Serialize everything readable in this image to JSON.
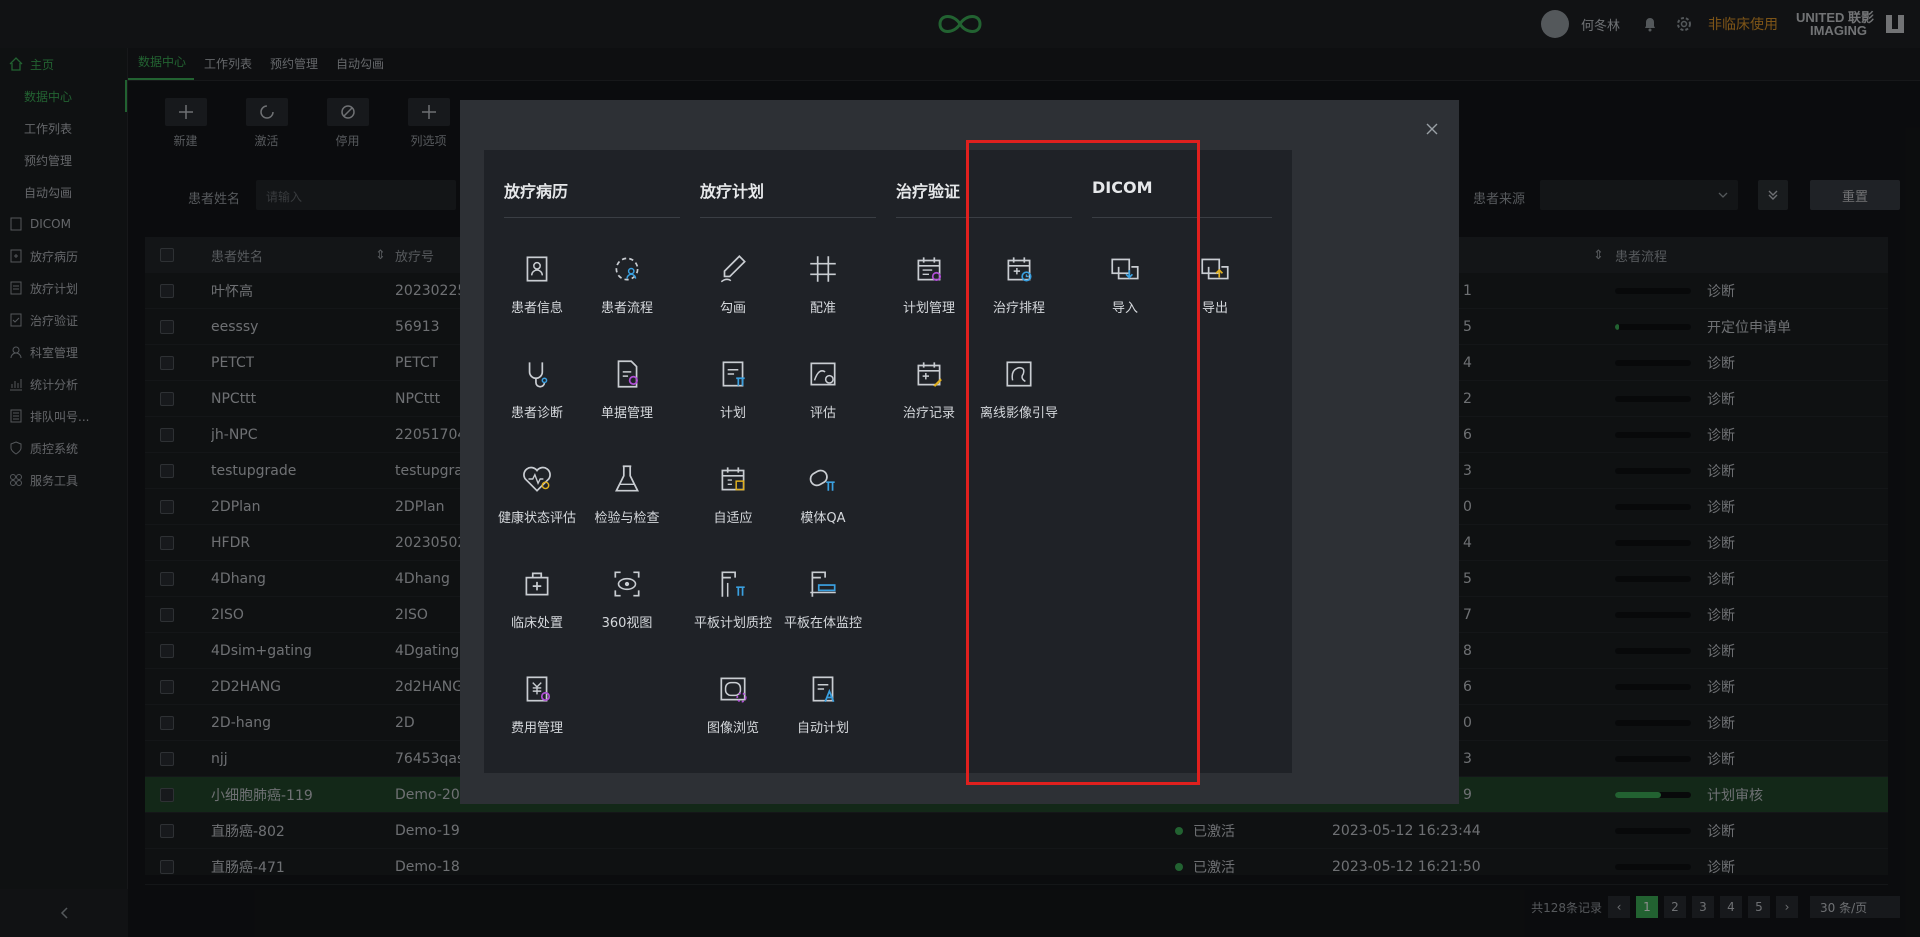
{
  "header": {
    "username": "何冬林",
    "nonclinical_label": "非临床使用",
    "brand_line1": "UNITED 联影",
    "brand_line2": "IMAGING"
  },
  "sidebar": {
    "items": [
      {
        "label": "主页",
        "icon": "home-icon"
      },
      {
        "label": "数据中心"
      },
      {
        "label": "工作列表"
      },
      {
        "label": "预约管理"
      },
      {
        "label": "自动勾画"
      },
      {
        "label": "DICOM",
        "icon": "file-icon"
      },
      {
        "label": "放疗病历",
        "icon": "record-icon"
      },
      {
        "label": "放疗计划",
        "icon": "plan-icon"
      },
      {
        "label": "治疗验证",
        "icon": "verify-icon"
      },
      {
        "label": "科室管理",
        "icon": "dept-icon"
      },
      {
        "label": "统计分析",
        "icon": "chart-icon"
      },
      {
        "label": "排队叫号...",
        "icon": "queue-icon"
      },
      {
        "label": "质控系统",
        "icon": "shield-icon"
      },
      {
        "label": "服务工具",
        "icon": "tools-icon"
      }
    ]
  },
  "tabs": [
    "数据中心",
    "工作列表",
    "预约管理",
    "自动勾画"
  ],
  "toolbar": [
    "新建",
    "激活",
    "停用",
    "列选项"
  ],
  "filters": {
    "patient_name_label": "患者姓名",
    "patient_name_placeholder": "请输入",
    "source_label": "患者来源",
    "reset_label": "重置"
  },
  "table": {
    "columns": [
      "患者姓名",
      "放疗号",
      "患者流程"
    ],
    "rows": [
      {
        "name": "叶怀高",
        "id": "20230225",
        "tail": "1",
        "flow": "诊断",
        "progress": 0
      },
      {
        "name": "eesssy",
        "id": "56913",
        "tail": "5",
        "flow": "开定位申请单",
        "progress": 0.05
      },
      {
        "name": "PETCT",
        "id": "PETCT",
        "tail": "4",
        "flow": "诊断",
        "progress": 0
      },
      {
        "name": "NPCttt",
        "id": "NPCttt",
        "tail": "2",
        "flow": "诊断",
        "progress": 0
      },
      {
        "name": "jh-NPC",
        "id": "22051704",
        "tail": "6",
        "flow": "诊断",
        "progress": 0
      },
      {
        "name": "testupgrade",
        "id": "testupgra",
        "tail": "3",
        "flow": "诊断",
        "progress": 0
      },
      {
        "name": "2DPlan",
        "id": "2DPlan",
        "tail": "0",
        "flow": "诊断",
        "progress": 0
      },
      {
        "name": "HFDR",
        "id": "20230502",
        "tail": "4",
        "flow": "诊断",
        "progress": 0
      },
      {
        "name": "4Dhang",
        "id": "4Dhang",
        "tail": "5",
        "flow": "诊断",
        "progress": 0
      },
      {
        "name": "2ISO",
        "id": "2ISO",
        "tail": "7",
        "flow": "诊断",
        "progress": 0
      },
      {
        "name": "4Dsim+gating",
        "id": "4Dgating",
        "tail": "8",
        "flow": "诊断",
        "progress": 0
      },
      {
        "name": "2D2HANG",
        "id": "2d2HANG",
        "tail": "6",
        "flow": "诊断",
        "progress": 0
      },
      {
        "name": "2D-hang",
        "id": "2D",
        "tail": "0",
        "flow": "诊断",
        "progress": 0
      },
      {
        "name": "njj",
        "id": "76453qas",
        "tail": "3",
        "flow": "诊断",
        "progress": 0
      },
      {
        "name": "小细胞肺癌-119",
        "id": "Demo-20",
        "tail": "9",
        "flow": "计划审核",
        "progress": 0.6,
        "selected": true
      },
      {
        "name": "直肠癌-802",
        "id": "Demo-19",
        "status": "已激活",
        "time": "2023-05-12 16:23:44",
        "flow": "诊断",
        "progress": 0
      },
      {
        "name": "直肠癌-471",
        "id": "Demo-18",
        "status": "已激活",
        "time": "2023-05-12 16:21:50",
        "flow": "诊断",
        "progress": 0
      }
    ]
  },
  "pager": {
    "total": "共128条记录",
    "pages": [
      "1",
      "2",
      "3",
      "4",
      "5"
    ],
    "per_page": "30 条/页"
  },
  "modal": {
    "panels": [
      {
        "title": "放疗病历",
        "items": [
          "患者信息",
          "患者流程",
          "患者诊断",
          "单据管理",
          "健康状态评估",
          "检验与检查",
          "临床处置",
          "360视图",
          "费用管理"
        ]
      },
      {
        "title": "放疗计划",
        "items": [
          "勾画",
          "配准",
          "计划",
          "评估",
          "自适应",
          "模体QA",
          "平板计划质控",
          "平板在体监控",
          "图像浏览",
          "自动计划"
        ]
      },
      {
        "title": "治疗验证",
        "items": [
          "计划管理",
          "治疗排程",
          "治疗记录",
          "离线影像引导"
        ]
      },
      {
        "title": "DICOM",
        "items": [
          "导入",
          "导出"
        ]
      }
    ]
  },
  "colors": {
    "accent": "#3fb35a",
    "highlight": "#e0201e",
    "warning": "#e39a2a"
  }
}
